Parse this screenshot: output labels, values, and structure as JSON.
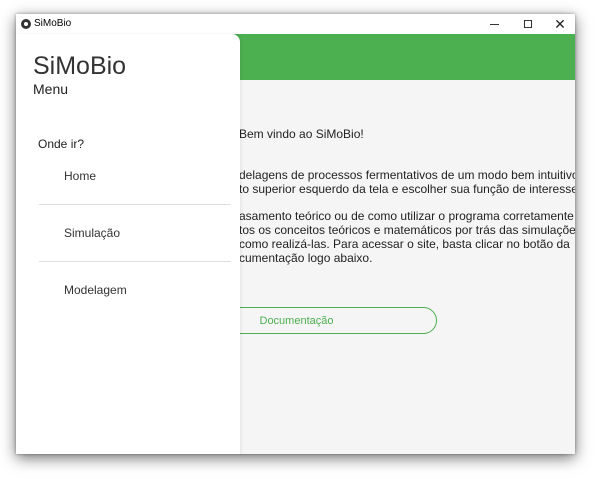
{
  "window": {
    "title": "SiMoBio"
  },
  "main": {
    "welcome": "Bem vindo ao SiMoBio!",
    "paragraph1": [
      "delagens de processos fermentativos de um modo bem intuitivo!",
      "to superior esquerdo da tela e escolher sua função de interesse."
    ],
    "paragraph2": [
      "asamento teórico ou de como utilizar o programa corretamente,",
      "tos os conceitos teóricos e matemáticos por trás das simulações",
      "como realizá-las. Para acessar o site, basta clicar no botão da",
      "cumentação logo abaixo."
    ],
    "doc_button": "Documentação"
  },
  "drawer": {
    "title": "SiMoBio",
    "subtitle": "Menu",
    "section_label": "Onde ir?",
    "items": [
      "Home",
      "Simulação",
      "Modelagem"
    ]
  },
  "colors": {
    "accent": "#4caf50",
    "background": "#f5f5f5",
    "drawer": "#ffffff"
  },
  "icons": {
    "app": "app-icon",
    "minimize": "minimize-icon",
    "maximize": "maximize-icon",
    "close": "close-icon"
  }
}
